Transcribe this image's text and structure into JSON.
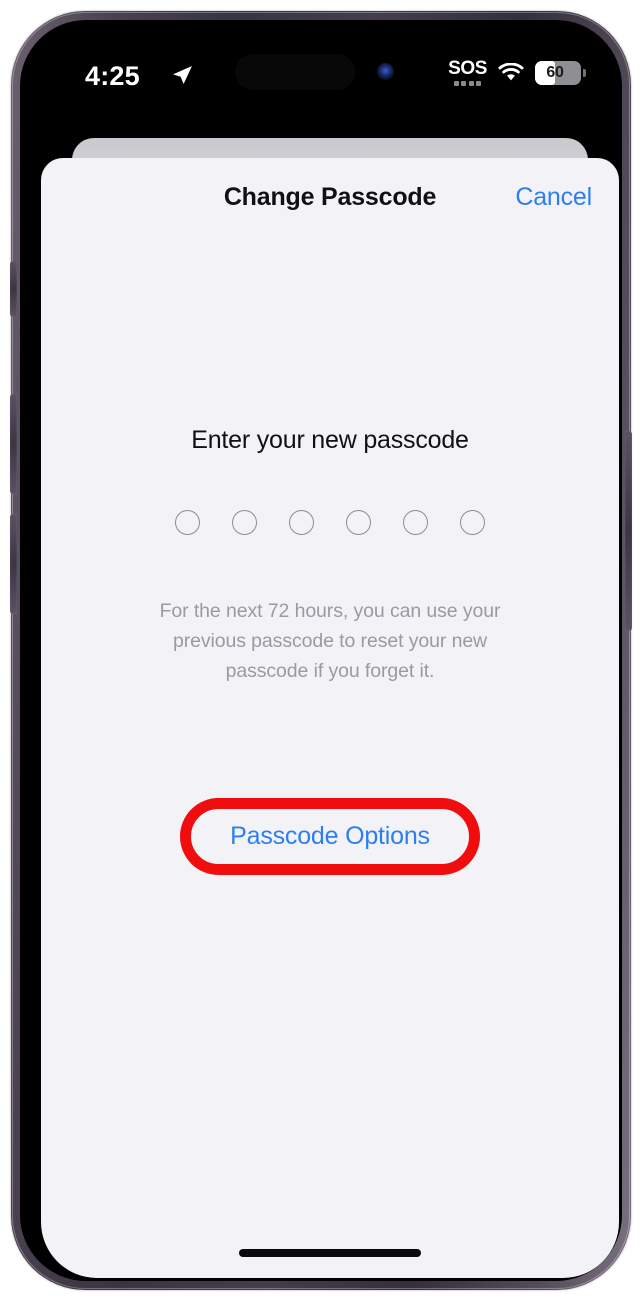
{
  "status_bar": {
    "time": "4:25",
    "location_arrow_icon": "location-arrow-icon",
    "cellular_label": "SOS",
    "signal_dots": 4,
    "wifi_icon": "wifi-icon",
    "battery_percent_text": "60",
    "battery_percent_value": 60
  },
  "sheet": {
    "title": "Change Passcode",
    "cancel_label": "Cancel",
    "prompt": "Enter your new passcode",
    "passcode_length": 6,
    "passcode_entered": 0,
    "hint": "For the next 72 hours, you can use your previous passcode to reset your new passcode if you forget it.",
    "passcode_options_label": "Passcode Options"
  },
  "annotation": {
    "highlight_color": "#f00d0d",
    "highlight_target": "Passcode Options"
  },
  "colors": {
    "accent_blue": "#2d7ff0",
    "sheet_background": "#f2f2f7",
    "primary_text": "#111114",
    "secondary_text": "#9a9aa0"
  }
}
